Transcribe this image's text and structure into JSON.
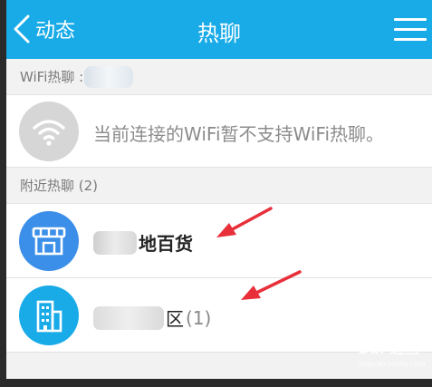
{
  "header": {
    "back_label": "动态",
    "title": "热聊"
  },
  "wifi_section": {
    "header": "WiFi热聊 :",
    "message": "当前连接的WiFi暂不支持WiFi热聊。"
  },
  "nearby_section": {
    "header": "附近热聊 (2)",
    "items": [
      {
        "name": "地百货",
        "icon": "shop-icon"
      },
      {
        "name": "区",
        "count": "(1)",
        "icon": "building-icon"
      }
    ]
  },
  "watermark": {
    "logo": "Bai 经验",
    "url": "jingyan.baidu.com"
  },
  "colors": {
    "accent": "#19abe8",
    "shop": "#3c8fe9",
    "arrow": "#e8303a"
  }
}
